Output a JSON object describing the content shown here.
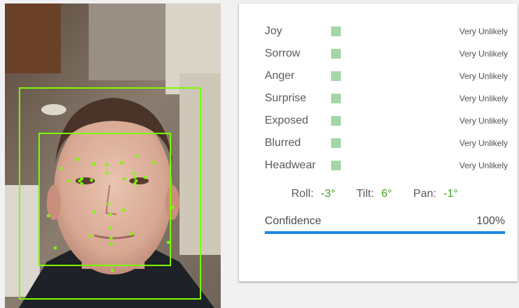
{
  "colors": {
    "accent_value": "#3f9e1e",
    "swatch": "#a5d6a7",
    "confidence_bar": "#1e88e5",
    "annotation": "#7cfc00"
  },
  "photo": {
    "description_icon": "face-photo"
  },
  "emotions": [
    {
      "name": "Joy",
      "likelihood": "Very Unlikely"
    },
    {
      "name": "Sorrow",
      "likelihood": "Very Unlikely"
    },
    {
      "name": "Anger",
      "likelihood": "Very Unlikely"
    },
    {
      "name": "Surprise",
      "likelihood": "Very Unlikely"
    },
    {
      "name": "Exposed",
      "likelihood": "Very Unlikely"
    },
    {
      "name": "Blurred",
      "likelihood": "Very Unlikely"
    },
    {
      "name": "Headwear",
      "likelihood": "Very Unlikely"
    }
  ],
  "angles": {
    "roll_label": "Roll:",
    "roll_value": "-3°",
    "tilt_label": "Tilt:",
    "tilt_value": "6°",
    "pan_label": "Pan:",
    "pan_value": "-1°"
  },
  "confidence": {
    "label": "Confidence",
    "value": "100%",
    "fraction": 1.0
  }
}
